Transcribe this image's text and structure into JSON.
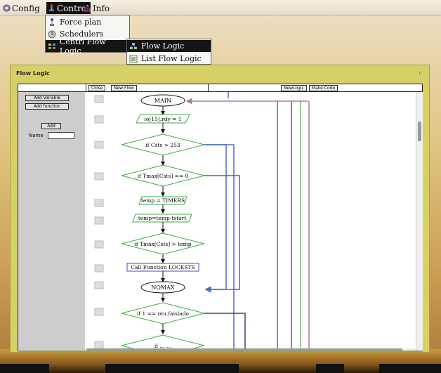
{
  "menubar": {
    "config": "Config",
    "control": "Control",
    "info": "Info"
  },
  "control_menu": {
    "items": [
      "Force plan",
      "Schedulers",
      "Centrl Flow Logic"
    ]
  },
  "submenu": {
    "items": [
      "Flow Logic",
      "List Flow Logic"
    ]
  },
  "window": {
    "title": "Flow Logic",
    "grip": "::"
  },
  "toolbar": {
    "close": "Close",
    "new_flow": "New Flow",
    "new_logic": "NewLogic",
    "make_code": "Make Code"
  },
  "left_panel": {
    "add_variable": "Add Variable",
    "add_function": "Add function",
    "name_label": "Name",
    "name_value": "",
    "add": "Add"
  },
  "flow": {
    "nodes": [
      "MAIN",
      "io[15].rdy = 1",
      "if Csts > 253",
      "if Tmax[Csts] == 0",
      "temp = TIMERS",
      "temp=temp-tstart",
      "if Tmax[Csts] > temp",
      "Call Function LOCKSTS",
      "NOMAX",
      "if 1 == otu.faislado",
      "if ... ..."
    ]
  },
  "colors": {
    "decision_stroke": "#3cae3c",
    "call_stroke": "#3a4fc0",
    "line_blue": "#4a6cc8",
    "line_purple": "#a03c9c",
    "line_green": "#7cb86c",
    "line_mauve": "#b07a98",
    "line_navy": "#4a3c7c",
    "window_bg": "#d7d066"
  }
}
